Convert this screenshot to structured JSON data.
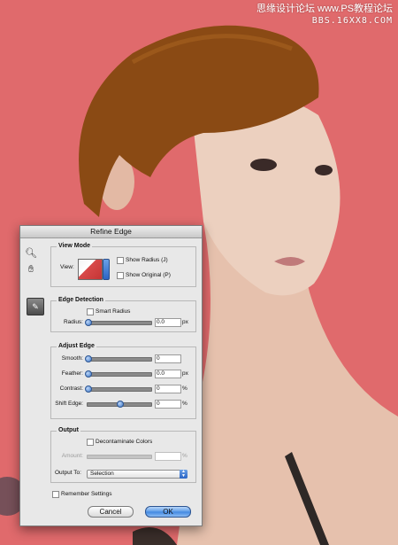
{
  "watermark": {
    "line1": "思缘设计论坛  www.PS教程论坛",
    "line2": "BBS.16XX8.COM"
  },
  "dialog": {
    "title": "Refine Edge",
    "view_mode": {
      "heading": "View Mode",
      "view_label": "View:",
      "show_radius_label": "Show Radius (J)",
      "show_original_label": "Show Original (P)"
    },
    "edge_detection": {
      "heading": "Edge Detection",
      "smart_radius_label": "Smart Radius",
      "radius_label": "Radius:",
      "radius_value": "0.0",
      "radius_unit": "px"
    },
    "adjust_edge": {
      "heading": "Adjust Edge",
      "smooth_label": "Smooth:",
      "smooth_value": "0",
      "feather_label": "Feather:",
      "feather_value": "0.0",
      "feather_unit": "px",
      "contrast_label": "Contrast:",
      "contrast_value": "0",
      "contrast_unit": "%",
      "shift_label": "Shift Edge:",
      "shift_value": "0",
      "shift_unit": "%"
    },
    "output": {
      "heading": "Output",
      "decontaminate_label": "Decontaminate Colors",
      "amount_label": "Amount:",
      "amount_unit": "%",
      "output_to_label": "Output To:",
      "output_to_value": "Selection"
    },
    "remember_label": "Remember Settings",
    "cancel_label": "Cancel",
    "ok_label": "OK"
  },
  "colors": {
    "background": "#e06a6c",
    "hair": "#8a4a14",
    "skin": "#e9c7b4"
  }
}
